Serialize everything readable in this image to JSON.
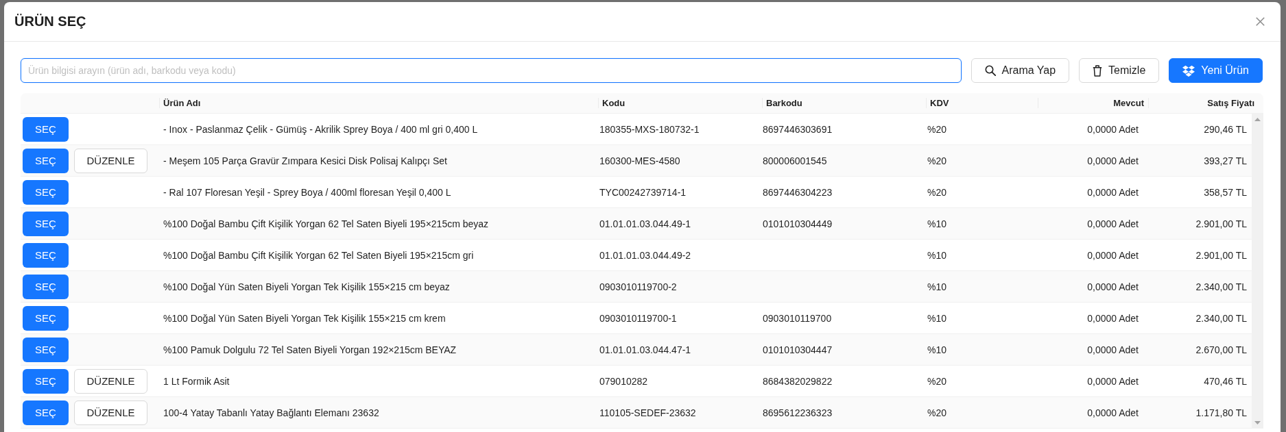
{
  "dialog": {
    "title": "ÜRÜN SEÇ"
  },
  "toolbar": {
    "search": {
      "placeholder": "Ürün bilgisi arayın (ürün adı, barkodu veya kodu)",
      "focused": true
    },
    "buttons": [
      {
        "label": "Arama Yap",
        "kind": "search",
        "primary": false
      },
      {
        "label": "Temizle",
        "kind": "clear",
        "primary": false
      },
      {
        "label": "Yeni Ürün",
        "kind": "new",
        "primary": true
      }
    ]
  },
  "table": {
    "columns": [
      "Ürün Adı",
      "Kodu",
      "Barkodu",
      "KDV",
      "Mevcut",
      "Satış Fiyatı"
    ],
    "rows": [
      {
        "select_label": "SEÇ",
        "name": "- Inox - Paslanmaz Çelik - Gümüş - Akrilik Sprey Boya / 400 ml gri 0,400 L",
        "code": "180355-MXS-180732-1",
        "barcode": "8697446303691",
        "vat": "%20",
        "stock": "0,0000 Adet",
        "price": "290,46 TL"
      },
      {
        "select_label": "SEÇ",
        "edit_label": "DÜZENLE",
        "name": "- Meşem 105 Parça Gravür Zımpara Kesici Disk Polisaj Kalıpçı Set",
        "code": "160300-MES-4580",
        "barcode": "800006001545",
        "vat": "%20",
        "stock": "0,0000 Adet",
        "price": "393,27 TL"
      },
      {
        "select_label": "SEÇ",
        "name": "- Ral 107 Floresan Yeşil - Sprey Boya / 400ml floresan Yeşil 0,400 L",
        "code": "TYC00242739714-1",
        "barcode": "8697446304223",
        "vat": "%20",
        "stock": "0,0000 Adet",
        "price": "358,57 TL"
      },
      {
        "select_label": "SEÇ",
        "name": "%100 Doğal Bambu Çift Kişilik Yorgan 62 Tel Saten Biyeli 195×215cm beyaz",
        "code": "01.01.01.03.044.49-1",
        "barcode": "0101010304449",
        "vat": "%10",
        "stock": "0,0000 Adet",
        "price": "2.901,00 TL"
      },
      {
        "select_label": "SEÇ",
        "name": "%100 Doğal Bambu Çift Kişilik Yorgan 62 Tel Saten Biyeli 195×215cm gri",
        "code": "01.01.01.03.044.49-2",
        "vat": "%10",
        "stock": "0,0000 Adet",
        "price": "2.901,00 TL"
      },
      {
        "select_label": "SEÇ",
        "name": "%100 Doğal Yün Saten Biyeli Yorgan Tek Kişilik 155×215 cm beyaz",
        "code": "0903010119700-2",
        "vat": "%10",
        "stock": "0,0000 Adet",
        "price": "2.340,00 TL"
      },
      {
        "select_label": "SEÇ",
        "name": "%100 Doğal Yün Saten Biyeli Yorgan Tek Kişilik 155×215 cm krem",
        "code": "0903010119700-1",
        "barcode": "0903010119700",
        "vat": "%10",
        "stock": "0,0000 Adet",
        "price": "2.340,00 TL"
      },
      {
        "select_label": "SEÇ",
        "name": "%100 Pamuk Dolgulu 72 Tel Saten Biyeli Yorgan 192×215cm BEYAZ",
        "code": "01.01.01.03.044.47-1",
        "barcode": "0101010304447",
        "vat": "%10",
        "stock": "0,0000 Adet",
        "price": "2.670,00 TL"
      },
      {
        "select_label": "SEÇ",
        "edit_label": "DÜZENLE",
        "name": "1 Lt Formik Asit",
        "code": "079010282",
        "barcode": "8684382029822",
        "vat": "%20",
        "stock": "0,0000 Adet",
        "price": "470,46 TL"
      },
      {
        "select_label": "SEÇ",
        "edit_label": "DÜZENLE",
        "name": "100-4 Yatay Tabanlı Yatay Bağlantı Elemanı 23632",
        "code": "110105-SEDEF-23632",
        "barcode": "8695612236323",
        "vat": "%20",
        "stock": "0,0000 Adet",
        "price": "1.171,80 TL"
      }
    ]
  }
}
